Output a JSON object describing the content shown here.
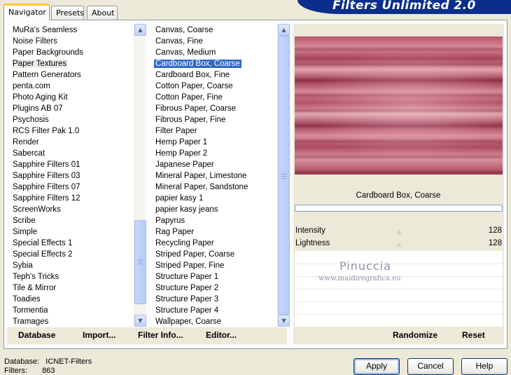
{
  "tabs": [
    {
      "label": "Navigator"
    },
    {
      "label": "Presets"
    },
    {
      "label": "About"
    }
  ],
  "title": "Filters Unlimited 2.0",
  "categories": {
    "items": [
      "MuRa's Seamless",
      "Noise Filters",
      "Paper Backgrounds",
      "Paper Textures",
      "Pattern Generators",
      "penta.com",
      "Photo Aging Kit",
      "Plugins AB 07",
      "Psychosis",
      "RCS Filter Pak 1.0",
      "Render",
      "Sabercat",
      "Sapphire Filters 01",
      "Sapphire Filters 03",
      "Sapphire Filters 07",
      "Sapphire Filters 12",
      "ScreenWorks",
      "Scribe",
      "Simple",
      "Special Effects 1",
      "Special Effects 2",
      "Sybia",
      "Teph's Tricks",
      "Tile & Mirror",
      "Toadies",
      "Tormentia",
      "Tramages"
    ],
    "highlighted": "Paper Textures"
  },
  "filters": {
    "items": [
      "Canvas, Coarse",
      "Canvas, Fine",
      "Canvas, Medium",
      "Cardboard Box, Coarse",
      "Cardboard Box, Fine",
      "Cotton Paper, Coarse",
      "Cotton Paper, Fine",
      "Fibrous Paper, Coarse",
      "Fibrous Paper, Fine",
      "Filter Paper",
      "Hemp Paper 1",
      "Hemp Paper 2",
      "Japanese Paper",
      "Mineral Paper, Limestone",
      "Mineral Paper, Sandstone",
      "papier kasy 1",
      "papier kasy jeans",
      "Papyrus",
      "Rag Paper",
      "Recycling Paper",
      "Striped Paper, Coarse",
      "Striped Paper, Fine",
      "Structure Paper 1",
      "Structure Paper 2",
      "Structure Paper 3",
      "Structure Paper 4",
      "Wallpaper, Coarse"
    ],
    "selected": "Cardboard Box, Coarse"
  },
  "preview": {
    "filter_name": "Cardboard Box, Coarse",
    "params": [
      {
        "label": "Intensity",
        "value": "128"
      },
      {
        "label": "Lightness",
        "value": "128"
      }
    ]
  },
  "watermark": {
    "name": "Pinuccia",
    "url": "www.maidiregrafica.eu"
  },
  "toolbar_left": {
    "database": "Database",
    "import": "Import...",
    "filter_info": "Filter Info...",
    "editor": "Editor..."
  },
  "toolbar_right": {
    "randomize": "Randomize",
    "reset": "Reset"
  },
  "status": {
    "database_label": "Database:",
    "database_value": "ICNET-Filters",
    "filters_label": "Filters:",
    "filters_value": "863"
  },
  "buttons": {
    "apply": "Apply",
    "cancel": "Cancel",
    "help": "Help"
  },
  "colors": {
    "accent": "#316ac5",
    "banner": "#0a2e8a"
  }
}
